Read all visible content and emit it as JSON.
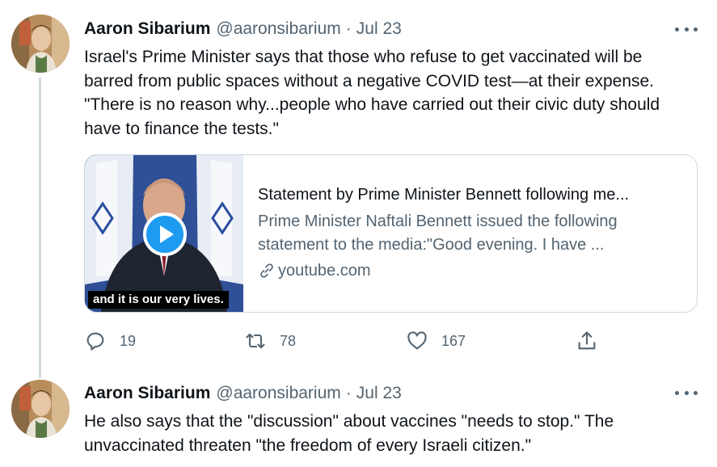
{
  "tweets": [
    {
      "author_name": "Aaron Sibarium",
      "handle": "@aaronsibarium",
      "separator": "·",
      "date": "Jul 23",
      "text": "Israel's Prime Minister says that those who refuse to get vaccinated will be\nbarred from public spaces without a negative COVID test—at their expense.\n\"There is no reason why...people who have carried out their civic duty should\nhave to finance the tests.\"",
      "card": {
        "title": "Statement by Prime Minister Bennett following me...",
        "description": "Prime Minister Naftali Bennett issued the following\nstatement to the media:\"Good evening. I have ...",
        "domain": "youtube.com",
        "video_caption": "and it is our very lives."
      },
      "counts": {
        "replies": "19",
        "retweets": "78",
        "likes": "167"
      }
    },
    {
      "author_name": "Aaron Sibarium",
      "handle": "@aaronsibarium",
      "separator": "·",
      "date": "Jul 23",
      "text": "He also says that the \"discussion\" about vaccines \"needs to stop.\" The\nunvaccinated threaten \"the freedom of every Israeli citizen.\""
    }
  ],
  "colors": {
    "text_primary": "#0f1419",
    "text_secondary": "#536471",
    "border": "#cfd9de",
    "accent": "#1d9bf0"
  },
  "icons": [
    "more-icon",
    "reply-icon",
    "retweet-icon",
    "like-icon",
    "share-icon",
    "link-icon",
    "play-icon"
  ]
}
